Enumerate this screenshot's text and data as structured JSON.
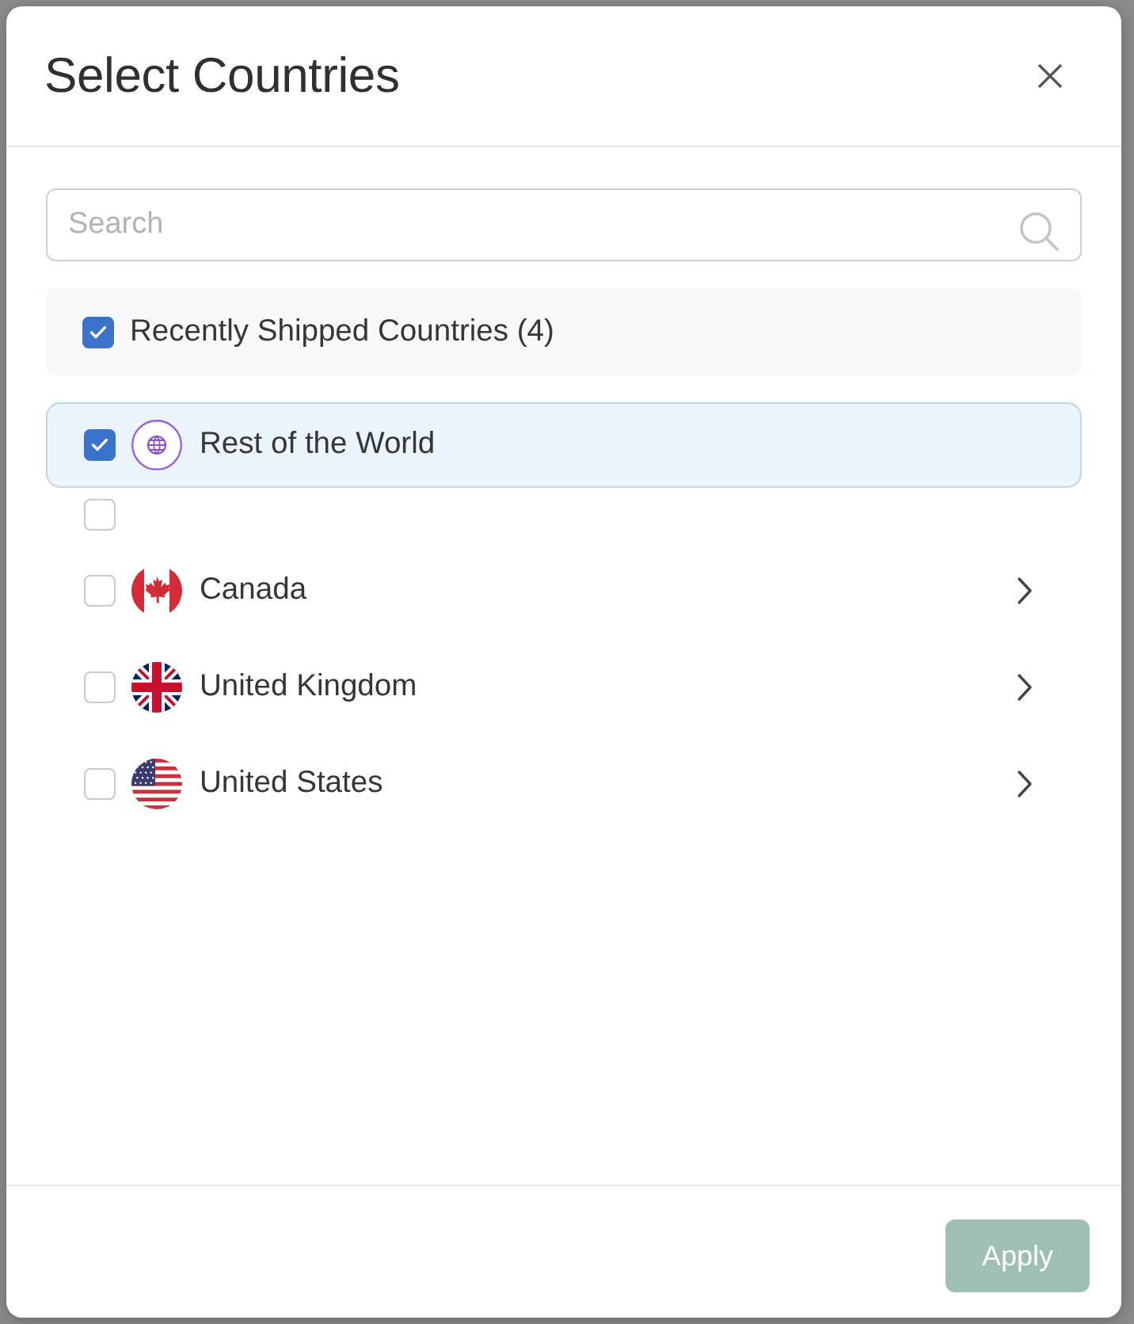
{
  "dialog": {
    "title": "Select Countries"
  },
  "search": {
    "placeholder": "Search"
  },
  "recently_shipped": {
    "label": "Recently Shipped Countries (4)",
    "checked": true
  },
  "items": [
    {
      "kind": "globe",
      "name": "Rest of the World",
      "checked": true,
      "expandable": false
    },
    {
      "kind": "blank",
      "checked": false,
      "expandable": false
    },
    {
      "kind": "canada",
      "name": "Canada",
      "checked": false,
      "expandable": true
    },
    {
      "kind": "uk",
      "name": "United Kingdom",
      "checked": false,
      "expandable": true
    },
    {
      "kind": "usa",
      "name": "United States",
      "checked": false,
      "expandable": true
    }
  ],
  "apply_button": {
    "label": "Apply",
    "disabled": true
  }
}
